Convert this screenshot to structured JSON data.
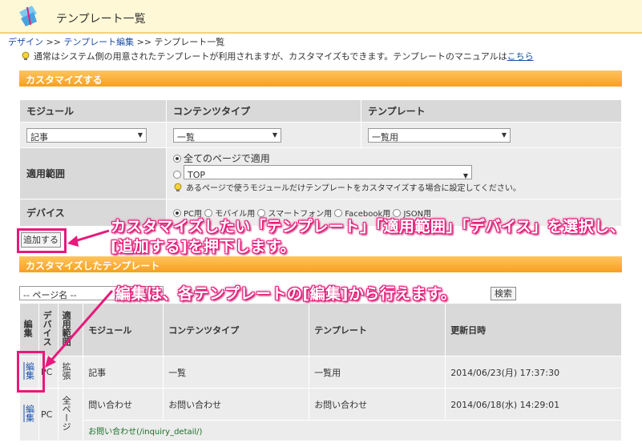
{
  "header": {
    "title": "テンプレート一覧"
  },
  "breadcrumb": {
    "item1": "デザイン",
    "item2": "テンプレート編集",
    "item3": "テンプレート一覧",
    "sep": ">>"
  },
  "notice": {
    "text": "通常はシステム側の用意されたテンプレートが利用されますが、カスタマイズもできます。テンプレートのマニュアルは",
    "link": "こちら"
  },
  "customize_section": {
    "title": "カスタマイズする",
    "headers": {
      "module": "モジュール",
      "content_type": "コンテンツタイプ",
      "template": "テンプレート"
    },
    "module_select": "記事",
    "content_type_select": "一覧",
    "template_select": "一覧用",
    "scope_label": "適用範囲",
    "scope_all": "全てのページで適用",
    "scope_page_select": "TOP",
    "scope_hint": "あるページで使うモジュールだけテンプレートをカスタマイズする場合に設定してください。",
    "device_label": "デバイス",
    "device_options": [
      "PC用",
      "モバイル用",
      "スマートフォン用",
      "Facebook用",
      "JSON用"
    ],
    "add_button": "追加する"
  },
  "customized_section": {
    "title": "カスタマイズしたテンプレート",
    "filter_select": "-- ページ名 --",
    "search_button": "検索",
    "columns": {
      "edit": "編集",
      "device": "デバイス",
      "scope": "適用範囲",
      "module": "モジュール",
      "content_type": "コンテンツタイプ",
      "template": "テンプレート",
      "updated": "更新日時"
    },
    "rows": [
      {
        "edit": "編集",
        "device": "PC",
        "scope": "拡張",
        "module": "記事",
        "content_type": "一覧",
        "template": "一覧用",
        "updated": "2014/06/23(月) 17:37:30"
      },
      {
        "edit": "編集",
        "device": "PC",
        "scope": "全ページ",
        "module": "問い合わせ",
        "content_type": "お問い合わせ",
        "template": "お問い合わせ",
        "updated": "2014/06/18(水) 14:29:01",
        "sub": "お問い合わせ(/inquiry_detail/)"
      }
    ]
  },
  "callouts": {
    "line1": "カスタマイズしたい「テンプレート」「適用範囲」「デバイス」を選択し、",
    "line2": "[追加する]を押下します。",
    "line3": "編集は、各テンプレートの[編集]から行えます。"
  },
  "colors": {
    "accent": "#f7a021",
    "highlight": "#e8197a",
    "link": "#1b4fa8"
  }
}
